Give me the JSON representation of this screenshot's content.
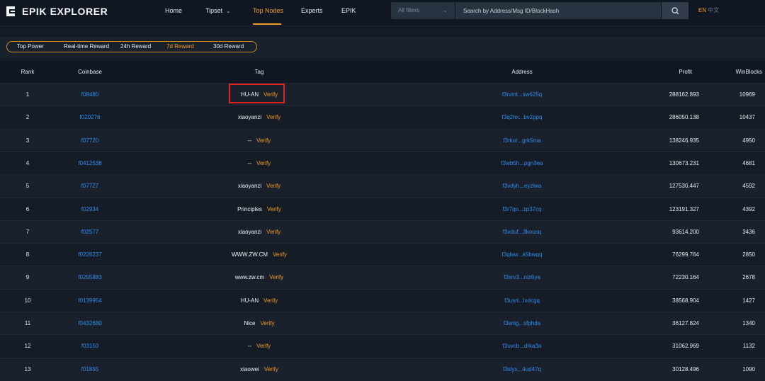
{
  "brand": {
    "name": "EPIK EXPLORER",
    "logo_icon": "epik-logo-icon",
    "accent": "#f39b22"
  },
  "nav": {
    "items": [
      {
        "label": "Home",
        "active": false
      },
      {
        "label": "Tipset",
        "active": false,
        "has_dropdown": true
      },
      {
        "label": "Top Nodes",
        "active": true
      },
      {
        "label": "Experts",
        "active": false
      },
      {
        "label": "EPIK",
        "active": false
      }
    ]
  },
  "search": {
    "filter_placeholder": "All filters",
    "placeholder": "Search by Address/Msg ID/BlockHash",
    "icon": "search-icon"
  },
  "lang": {
    "en": "EN",
    "zh": "中文"
  },
  "tabs": [
    {
      "label": "Top Power",
      "active": false
    },
    {
      "label": "Real-time Reward",
      "active": false
    },
    {
      "label": "24h Reward",
      "active": false
    },
    {
      "label": "7d Reward",
      "active": true
    },
    {
      "label": "30d Reward",
      "active": false
    }
  ],
  "table": {
    "headers": {
      "rank": "Rank",
      "coinbase": "Coinbase",
      "tag": "Tag",
      "address": "Address",
      "profit": "Profit",
      "winblocks": "WinBlocks"
    },
    "verify_label": "Verify",
    "rows": [
      {
        "rank": "1",
        "coinbase": "f08480",
        "tag": "HU-AN",
        "address": "f3rvmt...sw625q",
        "profit": "288162.893",
        "winblocks": "10969"
      },
      {
        "rank": "2",
        "coinbase": "f020276",
        "tag": "xiaoyanzi",
        "address": "f3q2hx...bv2ppq",
        "profit": "286050.138",
        "winblocks": "10437"
      },
      {
        "rank": "3",
        "coinbase": "f07720",
        "tag": "--",
        "address": "f3rkut...grk5ma",
        "profit": "138246.935",
        "winblocks": "4950"
      },
      {
        "rank": "4",
        "coinbase": "f0412538",
        "tag": "--",
        "address": "f3wb5h...pgn3ea",
        "profit": "130673.231",
        "winblocks": "4681"
      },
      {
        "rank": "5",
        "coinbase": "f07727",
        "tag": "xiaoyanzi",
        "address": "f3vdyh...eyziwa",
        "profit": "127530.447",
        "winblocks": "4592"
      },
      {
        "rank": "6",
        "coinbase": "f02934",
        "tag": "Principles",
        "address": "f3r7qn...zp37cq",
        "profit": "123191.327",
        "winblocks": "4392"
      },
      {
        "rank": "7",
        "coinbase": "f02577",
        "tag": "xiaoyanzi",
        "address": "f3vduf...3kousq",
        "profit": "93614.200",
        "winblocks": "3436"
      },
      {
        "rank": "8",
        "coinbase": "f0226237",
        "tag": "WWW.ZW.CM",
        "address": "f3qlaw...k5bwqq",
        "profit": "76299.764",
        "winblocks": "2850"
      },
      {
        "rank": "9",
        "coinbase": "f0255883",
        "tag": "www.zw.cm",
        "address": "f3srv3...niz6ya",
        "profit": "72230.164",
        "winblocks": "2678"
      },
      {
        "rank": "10",
        "coinbase": "f0139954",
        "tag": "HU-AN",
        "address": "f3usrt...lxdcgq",
        "profit": "38568.904",
        "winblocks": "1427"
      },
      {
        "rank": "11",
        "coinbase": "f0432680",
        "tag": "Nice",
        "address": "f3snig...sfphda",
        "profit": "36127.824",
        "winblocks": "1340"
      },
      {
        "rank": "12",
        "coinbase": "f03150",
        "tag": "--",
        "address": "f3uvcb...drka3a",
        "profit": "31062.969",
        "winblocks": "1132"
      },
      {
        "rank": "13",
        "coinbase": "f01855",
        "tag": "xiaowei",
        "address": "f3slyx...4ud47q",
        "profit": "30128.496",
        "winblocks": "1090"
      }
    ]
  },
  "highlight": {
    "color": "#e02424",
    "target_row": 1
  }
}
